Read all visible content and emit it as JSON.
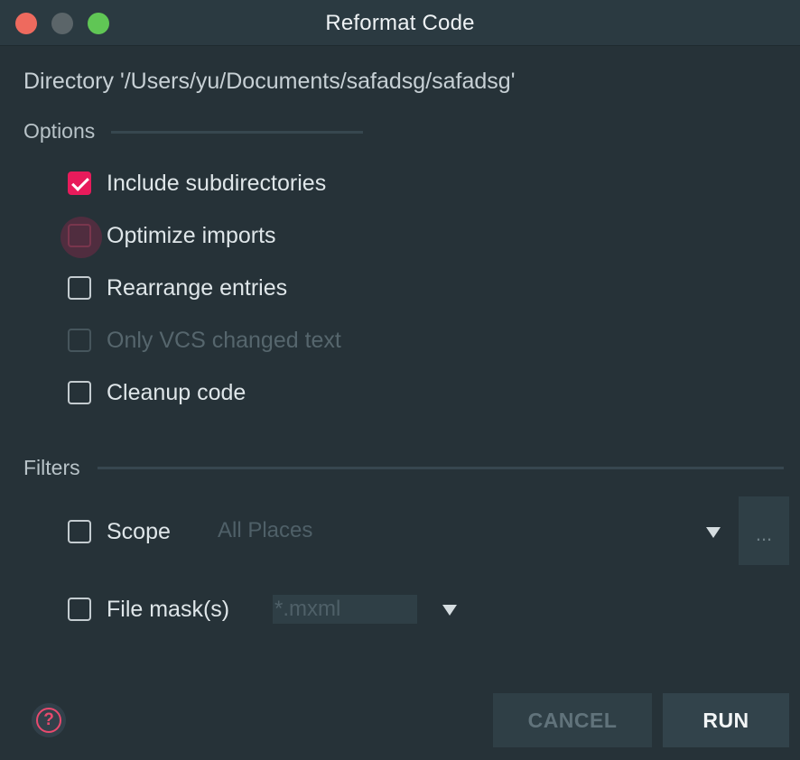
{
  "window": {
    "title": "Reformat Code"
  },
  "directory_label": "Directory '/Users/yu/Documents/safadsg/safadsg'",
  "options": {
    "section_label": "Options",
    "include_subdirectories": {
      "label": "Include subdirectories",
      "checked": true
    },
    "optimize_imports": {
      "label": "Optimize imports",
      "checked": false
    },
    "rearrange_entries": {
      "label": "Rearrange entries",
      "checked": false
    },
    "only_vcs_changed": {
      "label": "Only VCS changed text",
      "checked": false,
      "enabled": false
    },
    "cleanup_code": {
      "label": "Cleanup code",
      "checked": false
    }
  },
  "filters": {
    "section_label": "Filters",
    "scope": {
      "label": "Scope",
      "checked": false,
      "value": "All Places",
      "browse_label": "..."
    },
    "file_mask": {
      "label": "File mask(s)",
      "checked": false,
      "value": "*.mxml"
    }
  },
  "buttons": {
    "help_glyph": "?",
    "cancel_label": "CANCEL",
    "run_label": "RUN"
  },
  "colors": {
    "background": "#263238",
    "accent": "#e81b5b",
    "titlebar": "#2b3a41"
  },
  "icons": {
    "close": "close-icon",
    "minimize": "minimize-icon",
    "maximize": "maximize-icon",
    "help": "help-icon",
    "dropdown": "chevron-down-icon"
  }
}
